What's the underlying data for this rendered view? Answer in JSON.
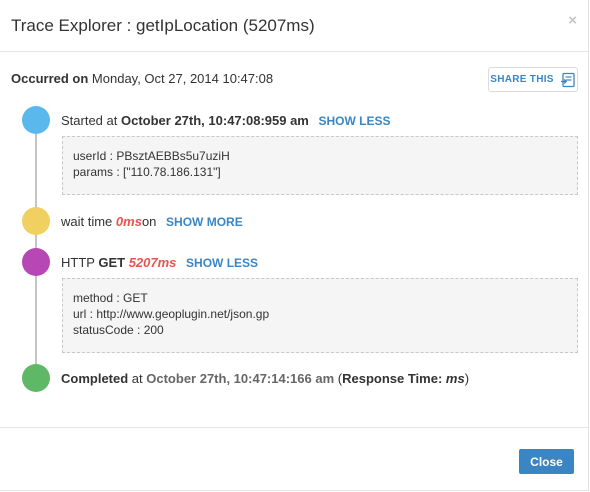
{
  "header": {
    "title": "Trace Explorer : getIpLocation (5207ms)",
    "close_glyph": "×"
  },
  "occurred": {
    "label": "Occurred on",
    "value": "Monday, Oct 27, 2014 10:47:08"
  },
  "share": {
    "label": "SHARE THIS",
    "icon": "share-icon"
  },
  "timeline": {
    "started": {
      "prefix": "Started at",
      "time": "October 27th, 10:47:08:959 am",
      "toggle": "SHOW LESS",
      "details": [
        "userId : PBsztAEBBs5u7uziH",
        "params : [\"110.78.186.131\"]"
      ],
      "color": "#5ab8ec"
    },
    "wait": {
      "prefix": "wait time",
      "value": "0ms",
      "suffix": "on",
      "toggle": "SHOW MORE",
      "color": "#f0d060"
    },
    "http": {
      "prefix": "HTTP",
      "method": "GET",
      "duration": "5207ms",
      "toggle": "SHOW LESS",
      "details": [
        "method : GET",
        "url : http://www.geoplugin.net/json.gp",
        "statusCode : 200"
      ],
      "color": "#b847b6"
    },
    "completed": {
      "label": "Completed",
      "at": "at",
      "time": "October 27th, 10:47:14:166 am",
      "open_paren": "(",
      "response_label": "Response Time:",
      "response_value": "ms",
      "close_paren": ")",
      "color": "#5fb865"
    }
  },
  "footer": {
    "close_label": "Close"
  }
}
